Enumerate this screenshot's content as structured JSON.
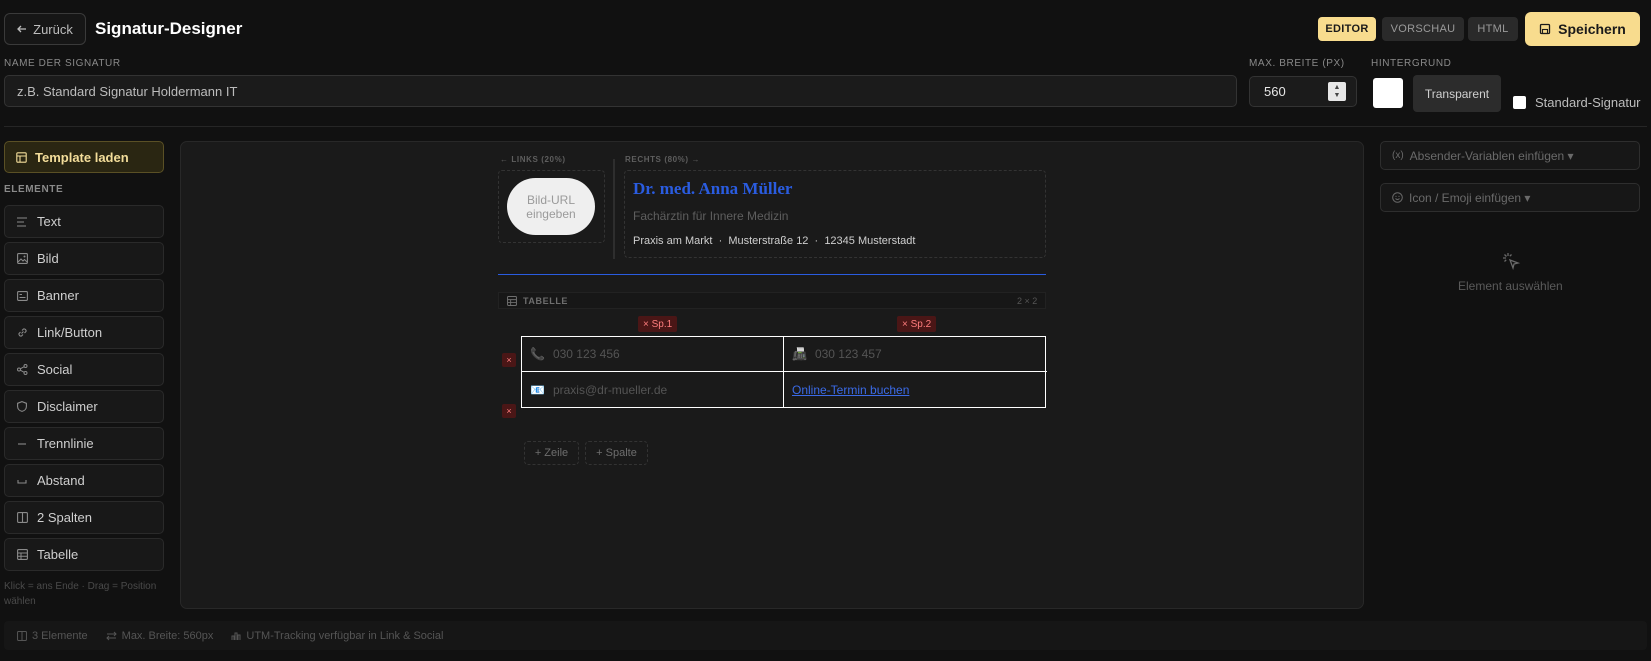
{
  "header": {
    "back_label": "Zurück",
    "title": "Signatur-Designer",
    "tabs": [
      "EDITOR",
      "VORSCHAU",
      "HTML"
    ],
    "active_tab": "EDITOR",
    "save_label": "Speichern"
  },
  "settings": {
    "name_label": "NAME DER SIGNATUR",
    "name_placeholder": "z.B. Standard Signatur Holdermann IT",
    "width_label": "MAX. BREITE (PX)",
    "width_value": "560",
    "bg_label": "HINTERGRUND",
    "bg_color": "#ffffff",
    "transparent_label": "Transparent",
    "default_label": "Standard-Signatur",
    "default_checked": false
  },
  "sidebar": {
    "template_label": "Template laden",
    "elements_title": "ELEMENTE",
    "items": [
      {
        "label": "Text",
        "icon": "text-icon"
      },
      {
        "label": "Bild",
        "icon": "image-icon"
      },
      {
        "label": "Banner",
        "icon": "banner-icon"
      },
      {
        "label": "Link/Button",
        "icon": "link-icon"
      },
      {
        "label": "Social",
        "icon": "share-icon"
      },
      {
        "label": "Disclaimer",
        "icon": "shield-icon"
      },
      {
        "label": "Trennlinie",
        "icon": "minus-icon"
      },
      {
        "label": "Abstand",
        "icon": "spacing-icon"
      },
      {
        "label": "2 Spalten",
        "icon": "columns-icon"
      },
      {
        "label": "Tabelle",
        "icon": "table-icon"
      }
    ],
    "hint": "Klick = ans Ende · Drag = Position wählen"
  },
  "canvas": {
    "left_col_label": "← LINKS (20%)",
    "right_col_label": "RECHTS (80%) →",
    "image_placeholder": "Bild-URL eingeben",
    "name": "Dr. med. Anna Müller",
    "job_title": "Fachärztin für Innere Medizin",
    "address": "Praxis am Markt  ·  Musterstraße 12  ·  12345 Musterstadt",
    "accent_color": "#2a5ce0",
    "table": {
      "label": "TABELLE",
      "dims": "2 × 2",
      "col_tags": [
        "× Sp.1",
        "× Sp.2"
      ],
      "row_remove": "×",
      "cells": [
        {
          "icon": "📞",
          "text": "030 123 456"
        },
        {
          "icon": "📠",
          "text": "030 123 457"
        },
        {
          "icon": "📧",
          "text": "praxis@dr-mueller.de"
        },
        {
          "link": "Online-Termin buchen"
        }
      ]
    },
    "add_row": "+ Zeile",
    "add_col": "+ Spalte"
  },
  "right_panel": {
    "sender_vars": "Absender-Variablen einfügen ▾",
    "icon_emoji": "Icon / Emoji einfügen ▾",
    "empty_state": "Element auswählen"
  },
  "status": {
    "elements": "3 Elemente",
    "max_width": "Max. Breite: 560px",
    "utm": "UTM-Tracking verfügbar in Link & Social"
  }
}
